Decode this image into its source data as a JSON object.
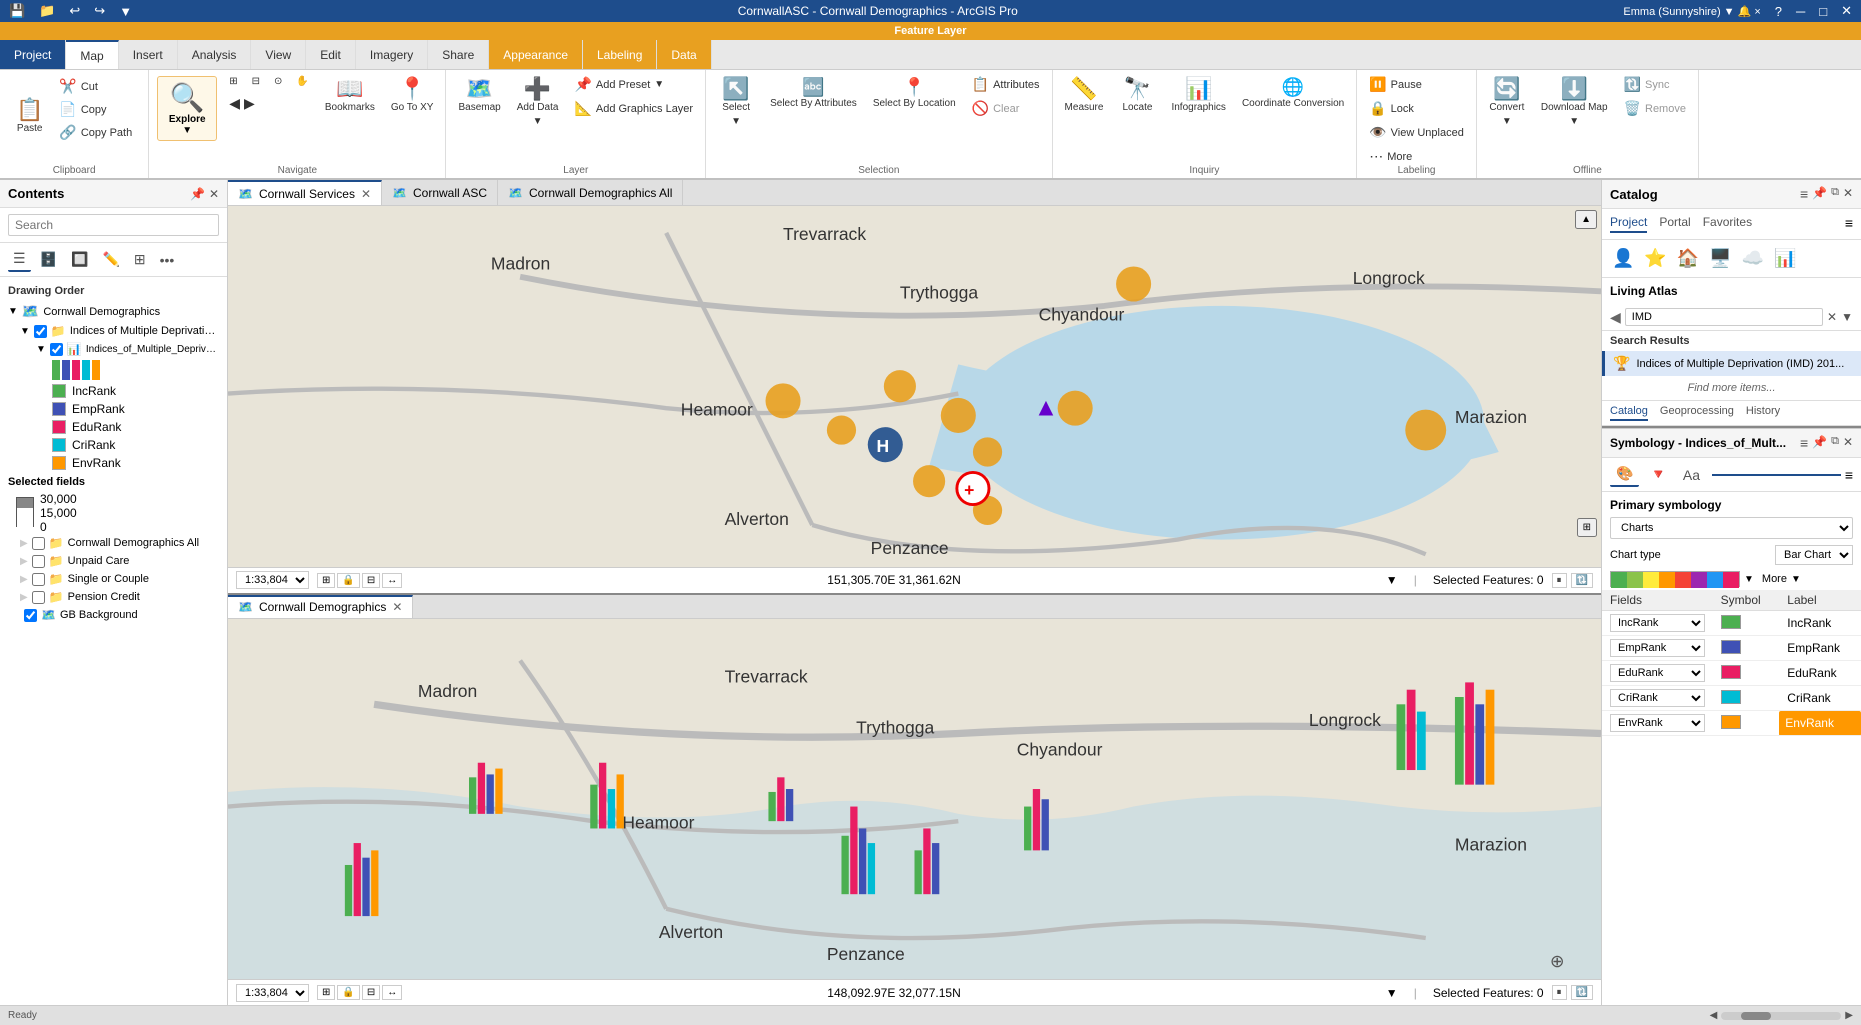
{
  "app": {
    "title": "CornwallASC - Cornwall Demographics - ArcGIS Pro",
    "feature_layer_label": "Feature Layer"
  },
  "qat": {
    "buttons": [
      "💾",
      "📁",
      "↩",
      "↩",
      "▼",
      "⚙"
    ]
  },
  "ribbon_tabs": [
    {
      "label": "Project",
      "state": "active-project"
    },
    {
      "label": "Map",
      "state": "active-map"
    },
    {
      "label": "Insert",
      "state": ""
    },
    {
      "label": "Analysis",
      "state": ""
    },
    {
      "label": "View",
      "state": ""
    },
    {
      "label": "Edit",
      "state": ""
    },
    {
      "label": "Imagery",
      "state": ""
    },
    {
      "label": "Share",
      "state": ""
    },
    {
      "label": "Appearance",
      "state": "feature-layer"
    },
    {
      "label": "Labeling",
      "state": "feature-layer"
    },
    {
      "label": "Data",
      "state": "feature-layer"
    }
  ],
  "ribbon": {
    "clipboard_group": {
      "label": "Clipboard",
      "paste_label": "Paste",
      "cut_label": "Cut",
      "copy_label": "Copy",
      "copy_path_label": "Copy Path"
    },
    "navigate_group": {
      "label": "Navigate",
      "explore_label": "Explore",
      "bookmarks_label": "Bookmarks",
      "go_to_xy_label": "Go To XY",
      "back_label": "◀",
      "forward_label": "▶"
    },
    "layer_group": {
      "label": "Layer",
      "basemap_label": "Basemap",
      "add_data_label": "Add Data",
      "add_preset_label": "Add Preset",
      "add_graphics_layer_label": "Add Graphics Layer"
    },
    "selection_group": {
      "label": "Selection",
      "select_label": "Select",
      "select_by_attr_label": "Select By Attributes",
      "select_by_loc_label": "Select By Location",
      "attributes_label": "Attributes",
      "clear_label": "Clear"
    },
    "inquiry_group": {
      "label": "Inquiry",
      "measure_label": "Measure",
      "locate_label": "Locate",
      "infographics_label": "Infographics",
      "coordinate_conversion_label": "Coordinate Conversion"
    },
    "labeling_group": {
      "label": "Labeling",
      "pause_label": "Pause",
      "lock_label": "Lock",
      "view_unplaced_label": "View Unplaced",
      "more_label": "More"
    },
    "offline_group": {
      "label": "Offline",
      "convert_label": "Convert",
      "download_map_label": "Download Map",
      "sync_label": "Sync",
      "remove_label": "Remove"
    }
  },
  "sidebar": {
    "title": "Contents",
    "search_placeholder": "Search",
    "drawing_order_label": "Drawing Order",
    "layers": [
      {
        "label": "Cornwall Demographics",
        "level": 0,
        "checked": true,
        "icon": "🗺️"
      },
      {
        "label": "Indices of Multiple Deprivation (I...",
        "level": 1,
        "checked": true,
        "icon": "📁"
      },
      {
        "label": "Indices_of_Multiple_Deprivation",
        "level": 2,
        "checked": true,
        "icon": "📊"
      },
      {
        "label": "Cornwall Demographics All",
        "level": 1,
        "checked": false,
        "icon": "📁"
      },
      {
        "label": "Unpaid Care",
        "level": 1,
        "checked": false,
        "icon": "📁"
      },
      {
        "label": "Single or Couple",
        "level": 1,
        "checked": false,
        "icon": "📁"
      },
      {
        "label": "Pension Credit",
        "level": 1,
        "checked": false,
        "icon": "📁"
      },
      {
        "label": "GB Background",
        "level": 1,
        "checked": true,
        "icon": "🗺️"
      }
    ],
    "legend": {
      "selected_fields_label": "Selected fields",
      "scale_values": [
        "30,000",
        "15,000",
        "0"
      ],
      "entries": [
        {
          "label": "IncRank",
          "color": "#4CAF50"
        },
        {
          "label": "EmpRank",
          "color": "#3F51B5"
        },
        {
          "label": "EduRank",
          "color": "#E91E63"
        },
        {
          "label": "CriRank",
          "color": "#00BCD4"
        },
        {
          "label": "EnvRank",
          "color": "#FF9800"
        }
      ]
    }
  },
  "maps": {
    "tabs": [
      {
        "label": "Cornwall Services",
        "active": true,
        "closable": true
      },
      {
        "label": "Cornwall ASC",
        "active": false,
        "closable": false
      },
      {
        "label": "Cornwall Demographics All",
        "active": false,
        "closable": false
      }
    ],
    "top_map": {
      "scale": "1:33,804",
      "coords": "151,305.70E 31,361.62N",
      "selected_features": "Selected Features: 0"
    },
    "bottom_tabs": [
      {
        "label": "Cornwall Demographics",
        "active": true,
        "closable": true
      }
    ],
    "bottom_map": {
      "scale": "1:33,804",
      "coords": "148,092.97E 32,077.15N",
      "selected_features": "Selected Features: 0"
    }
  },
  "catalog": {
    "title": "Catalog",
    "tabs": [
      "Project",
      "Portal",
      "Favorites"
    ],
    "icons": [
      "👤",
      "⭐",
      "🏠",
      "🖥️",
      "☁️",
      "📊"
    ],
    "living_atlas_label": "Living Atlas",
    "search_value": "IMD",
    "search_results_label": "Search Results",
    "search_result": "Indices of Multiple Deprivation (IMD) 201...",
    "find_more_label": "Find more items...",
    "bottom_tabs": [
      "Catalog",
      "Geoprocessing",
      "History"
    ]
  },
  "symbology": {
    "title": "Symbology - Indices_of_Mult...",
    "primary_label": "Primary symbology",
    "primary_value": "Charts",
    "chart_type_label": "Chart type",
    "chart_type_value": "Bar Chart",
    "colors": [
      "#4CAF50",
      "#8BC34A",
      "#FFEB3B",
      "#FF9800",
      "#F44336",
      "#9C27B0",
      "#2196F3"
    ],
    "more_label": "More",
    "table_headers": [
      "Fields",
      "Symbol",
      "Label"
    ],
    "fields": [
      {
        "field": "IncRank",
        "color": "#4CAF50",
        "label": "IncRank"
      },
      {
        "field": "EmpRank",
        "color": "#3F51B5",
        "label": "EmpRank"
      },
      {
        "field": "EduRank",
        "color": "#E91E63",
        "label": "EduRank"
      },
      {
        "field": "CriRank",
        "color": "#00BCD4",
        "label": "CriRank"
      },
      {
        "field": "EnvRank",
        "color": "#FF9800",
        "label": "EnvRank"
      }
    ]
  }
}
